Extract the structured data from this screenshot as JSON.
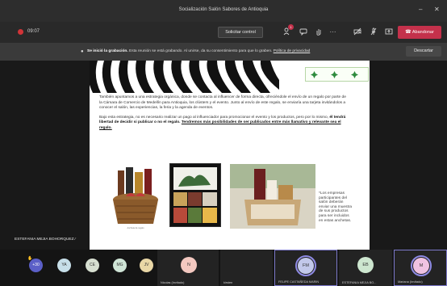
{
  "window": {
    "title": "Socialización Salón Sabores de Antioquia",
    "minimize": "–",
    "close": "✕"
  },
  "toolbar": {
    "timer": "09:07",
    "control_label": "Solicitar control",
    "chat_badge": "1",
    "more_label": "···",
    "leave_label": "Abandonar"
  },
  "banner": {
    "bold": "Se inició la grabación.",
    "text": "Esta reunión se está grabando. Al unirse, da su consentimiento para que lo graben.",
    "link": "Política de privacidad",
    "dismiss_label": "Descartar"
  },
  "slide": {
    "paragraph1": "También apuntamos a una estrategia orgánica, donde se contacta al influencer de forma directa, ofreciéndole el envío de un regalo por parte de la Cámara de Comercio de Medellín para Antioquia, los clústers y el evento. Junto al envío de este regalo, se enviaría una tarjeta invitándolos a conocer el salón, las experiencias, la feria y la agenda de eventos.",
    "paragraph2_start": "Bajo esta estrategia, no es necesario realizar un pago al influenciador para promocionar el evento y los productos, pero por lo mismo,",
    "paragraph2_bold": "él tendrá libertad de decidir si publicar o no el regalo.",
    "paragraph2_underline": "Tendremos más posibilidades de ser publicados entre más llamativo y relevante sea el regalo.",
    "basket_caption": "Ancheta de regalo",
    "side_note": "*Los empresas participantes del salón deberán enviar una muestra de sus productos para ser incluidos en estas anchetas."
  },
  "presenter_name": "ESTEFANIA MEJIA BOHORQUEZ",
  "participants": {
    "overflow": "+30",
    "small": [
      {
        "initials": "YA",
        "color": "#c7dfe9"
      },
      {
        "initials": "CE",
        "color": "#d7dfd1"
      },
      {
        "initials": "MG",
        "color": "#cfe4d6"
      },
      {
        "initials": "JV",
        "color": "#e9d7a6"
      }
    ],
    "tiles": [
      {
        "initials": "N",
        "name": "Nicolas (Invitado)",
        "color": "#f3c8c0"
      },
      {
        "initials": "",
        "name": "kirsten",
        "color": ""
      },
      {
        "initials": "FM",
        "name": "FELIPE CASTAÑEDA MARIN",
        "color": "#c2c8ea"
      },
      {
        "initials": "EB",
        "name": "ESTEFANIA MEJIA BO...",
        "color": "#cde6cf"
      },
      {
        "initials": "M",
        "name": "Mariana (Invitado)",
        "color": "#efc2e2"
      }
    ]
  },
  "colors": {
    "accent": "#7d7acb",
    "leave": "#c4314b",
    "recording": "#d13438"
  }
}
